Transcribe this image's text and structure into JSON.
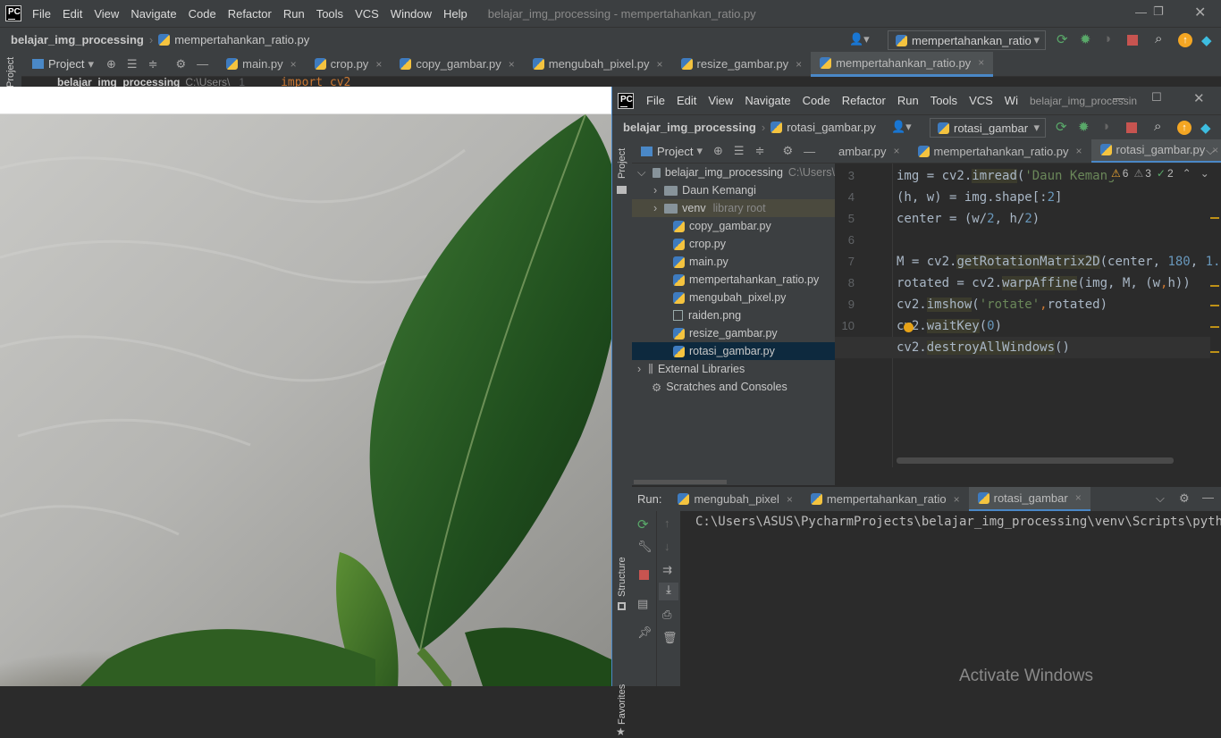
{
  "back_window": {
    "title": "belajar_img_processing - mempertahankan_ratio.py",
    "menu": [
      "File",
      "Edit",
      "View",
      "Navigate",
      "Code",
      "Refactor",
      "Run",
      "Tools",
      "VCS",
      "Window",
      "Help"
    ],
    "breadcrumb": [
      "belajar_img_processing",
      "mempertahankan_ratio.py"
    ],
    "run_config": "mempertahankan_ratio",
    "project_label": "Project",
    "tabs": [
      "main.py",
      "crop.py",
      "copy_gambar.py",
      "mengubah_pixel.py",
      "resize_gambar.py",
      "mempertahankan_ratio.py"
    ],
    "side_label": "Project",
    "peek_tree": "belajar_img_processing",
    "peek_path": "C:\\Users\\",
    "peek_linenum": "1",
    "peek_code": "import cv2"
  },
  "front_window": {
    "menu": [
      "File",
      "Edit",
      "View",
      "Navigate",
      "Code",
      "Refactor",
      "Run",
      "Tools",
      "VCS",
      "Wi"
    ],
    "title": "belajar_img_processin",
    "breadcrumb": [
      "belajar_img_processing",
      "rotasi_gambar.py"
    ],
    "run_config": "rotasi_gambar",
    "project_label": "Project",
    "tabs": [
      "ambar.py",
      "mempertahankan_ratio.py",
      "rotasi_gambar.py"
    ],
    "inspections": {
      "warnings": "6",
      "weak": "3",
      "ok": "2"
    },
    "tree": {
      "root": "belajar_img_processing",
      "root_path": "C:\\Users\\",
      "folders": [
        "Daun Kemangi",
        "venv"
      ],
      "venv_note": "library root",
      "files": [
        "copy_gambar.py",
        "crop.py",
        "main.py",
        "mempertahankan_ratio.py",
        "mengubah_pixel.py",
        "raiden.png",
        "resize_gambar.py",
        "rotasi_gambar.py"
      ],
      "external": "External Libraries",
      "scratches": "Scratches and Consoles"
    },
    "code": {
      "line_numbers": [
        "3",
        "4",
        "5",
        "6",
        "7",
        "8",
        "9",
        "10",
        "11"
      ],
      "lines": [
        [
          {
            "t": "img = cv2.",
            "c": "#a9b7c6"
          },
          {
            "t": "imread",
            "c": "#a9b7c6",
            "bg": "#3b3b2d"
          },
          {
            "t": "(",
            "c": "#a9b7c6"
          },
          {
            "t": "'Daun Kemang",
            "c": "#6a8759"
          }
        ],
        [
          {
            "t": "(h, w) = img.shape[:",
            "c": "#a9b7c6"
          },
          {
            "t": "2",
            "c": "#6897bb"
          },
          {
            "t": "]",
            "c": "#a9b7c6"
          }
        ],
        [
          {
            "t": "center = (w/",
            "c": "#a9b7c6"
          },
          {
            "t": "2",
            "c": "#6897bb"
          },
          {
            "t": ", h/",
            "c": "#a9b7c6"
          },
          {
            "t": "2",
            "c": "#6897bb"
          },
          {
            "t": ")",
            "c": "#a9b7c6"
          }
        ],
        [],
        [
          {
            "t": "M = cv2.",
            "c": "#a9b7c6"
          },
          {
            "t": "getRotationMatrix2D",
            "c": "#a9b7c6",
            "bg": "#3b3b2d"
          },
          {
            "t": "(center, ",
            "c": "#a9b7c6"
          },
          {
            "t": "180",
            "c": "#6897bb"
          },
          {
            "t": ", ",
            "c": "#a9b7c6"
          },
          {
            "t": "1.0",
            "c": "#6897bb"
          },
          {
            "t": ")",
            "c": "#a9b7c6"
          }
        ],
        [
          {
            "t": "rotated = cv2.",
            "c": "#a9b7c6"
          },
          {
            "t": "warpAffine",
            "c": "#a9b7c6",
            "bg": "#3b3b2d"
          },
          {
            "t": "(img, M, (w",
            "c": "#a9b7c6"
          },
          {
            "t": ",",
            "c": "#cc7832"
          },
          {
            "t": "h))",
            "c": "#a9b7c6"
          }
        ],
        [
          {
            "t": "cv2.",
            "c": "#a9b7c6"
          },
          {
            "t": "imshow",
            "c": "#a9b7c6",
            "bg": "#3b3b2d"
          },
          {
            "t": "(",
            "c": "#a9b7c6"
          },
          {
            "t": "'rotate'",
            "c": "#6a8759"
          },
          {
            "t": ",",
            "c": "#cc7832"
          },
          {
            "t": "rotated)",
            "c": "#a9b7c6"
          }
        ],
        [
          {
            "t": "cv2.",
            "c": "#a9b7c6"
          },
          {
            "t": "waitKey",
            "c": "#a9b7c6",
            "bg": "#3b3b2d"
          },
          {
            "t": "(",
            "c": "#a9b7c6"
          },
          {
            "t": "0",
            "c": "#6897bb"
          },
          {
            "t": ")",
            "c": "#a9b7c6"
          }
        ],
        [
          {
            "t": "cv2.",
            "c": "#a9b7c6"
          },
          {
            "t": "destroyAllWindows",
            "c": "#a9b7c6",
            "bg": "#3b3b2d"
          },
          {
            "t": "()",
            "c": "#a9b7c6"
          }
        ]
      ]
    },
    "run": {
      "label": "Run:",
      "tabs": [
        "mengubah_pixel",
        "mempertahankan_ratio",
        "rotasi_gambar"
      ],
      "output": "C:\\Users\\ASUS\\PycharmProjects\\belajar_img_processing\\venv\\Scripts\\python.e"
    },
    "side_labels": [
      "Structure",
      "Favorites"
    ]
  },
  "watermark": "Activate Windows",
  "colors": {
    "bg": "#2b2b2b",
    "chrome": "#3c3f41",
    "selection": "#0d293e",
    "accent": "#4a88c7",
    "string": "#6a8759",
    "number": "#6897bb",
    "keyword": "#cc7832"
  }
}
